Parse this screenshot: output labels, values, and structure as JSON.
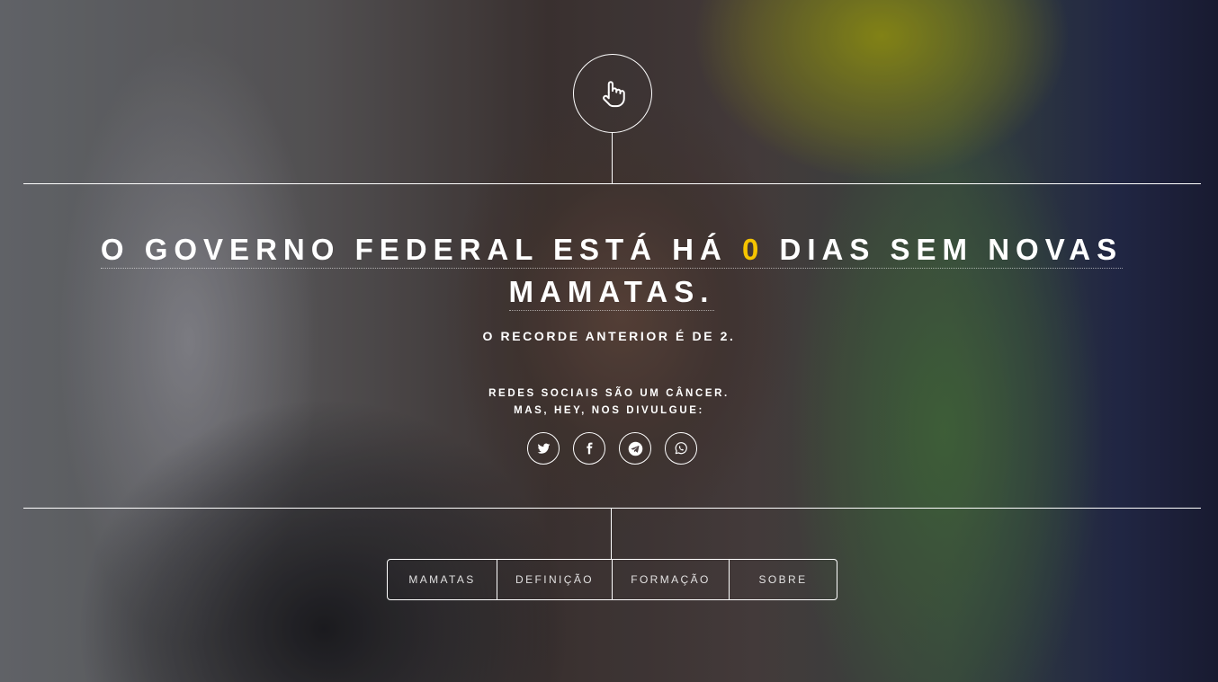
{
  "headline": {
    "before": "O GOVERNO FEDERAL ESTÁ HÁ ",
    "count": "0",
    "after_line1": " DIAS SEM NOVAS",
    "line2": "MAMATAS."
  },
  "record_text": "O RECORDE ANTERIOR É DE 2.",
  "share": {
    "line1": "REDES SOCIAIS SÃO UM CÂNCER.",
    "line2": "MAS, HEY, NOS DIVULGUE:"
  },
  "social_icons": [
    "twitter-icon",
    "facebook-icon",
    "telegram-icon",
    "whatsapp-icon"
  ],
  "nav": {
    "items": [
      {
        "label": "MAMATAS"
      },
      {
        "label": "DEFINIÇÃO"
      },
      {
        "label": "FORMAÇÃO"
      },
      {
        "label": "SOBRE"
      }
    ]
  },
  "colors": {
    "accent": "#f5c400",
    "line": "#ffffff"
  }
}
